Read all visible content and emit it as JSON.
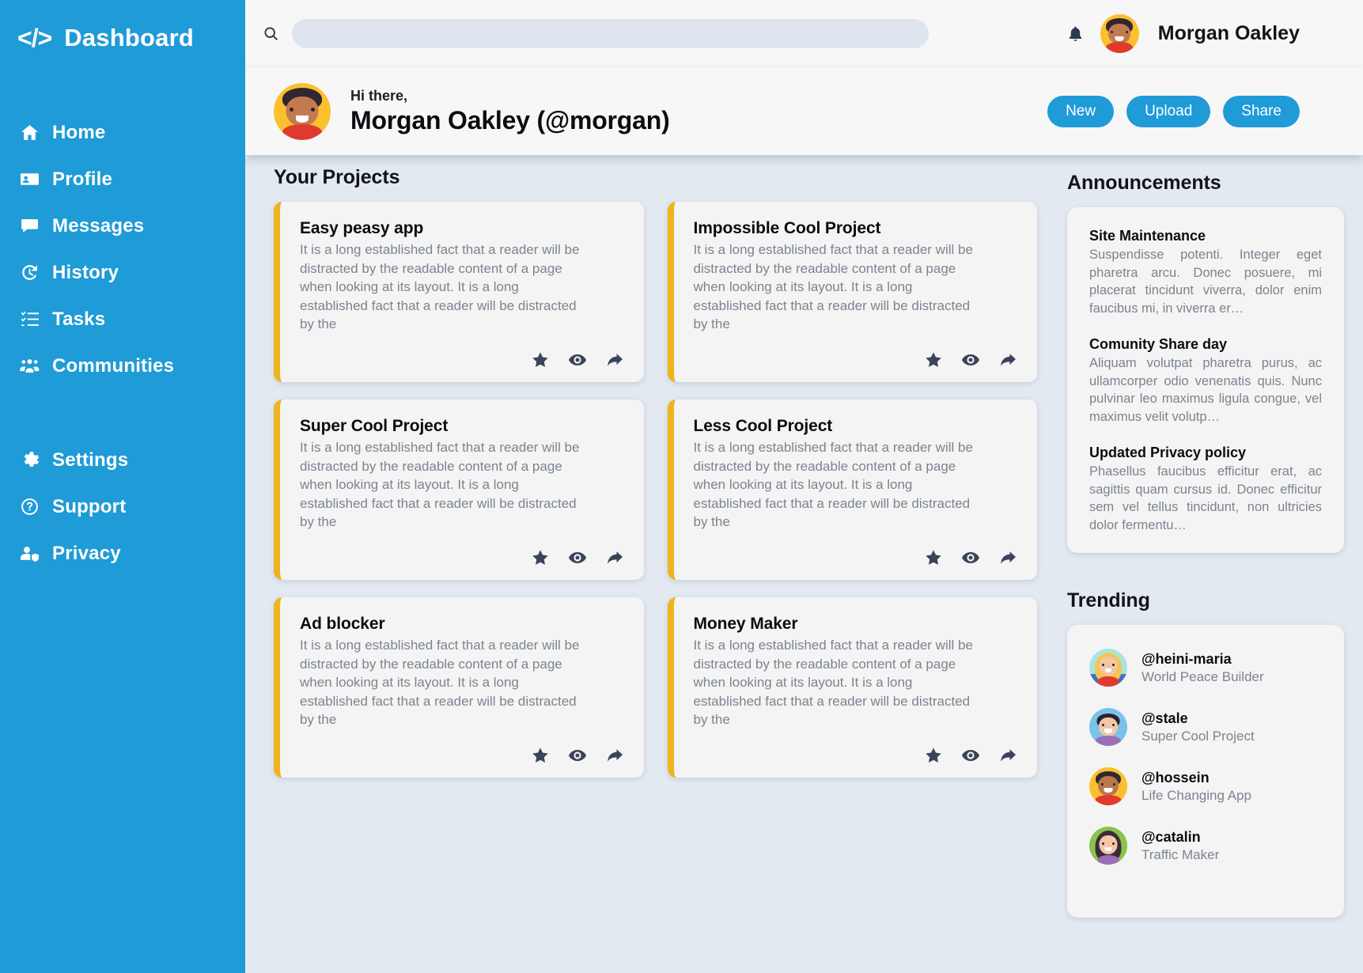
{
  "theme": {
    "sidebar_bg": "#1f9bd7",
    "accent_blue": "#1f9bd7",
    "card_accent": "#efb31e",
    "page_bg": "#e3e9f1",
    "card_bg": "#f4f4f4",
    "muted_text": "#7b8490"
  },
  "sidebar": {
    "logo_glyph": "</>",
    "logo_icon_name": "code-icon",
    "title": "Dashboard",
    "items": [
      {
        "label": "Home",
        "icon": "home-icon"
      },
      {
        "label": "Profile",
        "icon": "id-card-icon"
      },
      {
        "label": "Messages",
        "icon": "chat-bubble-icon"
      },
      {
        "label": "History",
        "icon": "history-clock-icon"
      },
      {
        "label": "Tasks",
        "icon": "checklist-icon"
      },
      {
        "label": "Communities",
        "icon": "people-group-icon"
      }
    ],
    "footer_items": [
      {
        "label": "Settings",
        "icon": "gear-icon"
      },
      {
        "label": "Support",
        "icon": "question-circle-icon"
      },
      {
        "label": "Privacy",
        "icon": "user-shield-icon"
      }
    ]
  },
  "topbar": {
    "search": {
      "value": "",
      "placeholder": "",
      "icon": "search-icon"
    },
    "bell_icon": "bell-icon",
    "avatar_icon": "user-avatar",
    "user_name": "Morgan Oakley"
  },
  "greeting": {
    "avatar_icon": "user-avatar-large",
    "hi_label": "Hi there,",
    "name": "Morgan Oakley (@morgan)",
    "actions": [
      {
        "label": "New"
      },
      {
        "label": "Upload"
      },
      {
        "label": "Share"
      }
    ]
  },
  "projects": {
    "heading": "Your Projects",
    "card_actions": [
      {
        "name": "star-icon",
        "title": "Favorite"
      },
      {
        "name": "eye-icon",
        "title": "View"
      },
      {
        "name": "share-icon",
        "title": "Share"
      }
    ],
    "items": [
      {
        "title": "Easy peasy app",
        "body": "It is a long established fact that a reader will be distracted by the readable content of a page when looking at its layout. It is a long established fact that a reader will be distracted by the"
      },
      {
        "title": "Impossible Cool Project",
        "body": "It is a long established fact that a reader will be distracted by the readable content of a page when looking at its layout. It is a long established fact that a reader will be distracted by the"
      },
      {
        "title": "Super Cool Project",
        "body": "It is a long established fact that a reader will be distracted by the readable content of a page when looking at its layout. It is a long established fact that a reader will be distracted by the"
      },
      {
        "title": "Less Cool Project",
        "body": "It is a long established fact that a reader will be distracted by the readable content of a page when looking at its layout. It is a long established fact that a reader will be distracted by the"
      },
      {
        "title": "Ad blocker",
        "body": "It is a long established fact that a reader will be distracted by the readable content of a page when looking at its layout. It is a long established fact that a reader will be distracted by the"
      },
      {
        "title": "Money Maker",
        "body": "It is a long established fact that a reader will be distracted by the readable content of a page when looking at its layout. It is a long established fact that a reader will be distracted by the"
      }
    ]
  },
  "announcements": {
    "heading": "Announcements",
    "items": [
      {
        "title": "Site Maintenance",
        "text": "Suspendisse potenti. Integer eget pharetra arcu. Donec posuere, mi placerat tincidunt viverra, dolor enim faucibus mi, in viverra er…"
      },
      {
        "title": "Comunity Share day",
        "text": "Aliquam volutpat pharetra purus, ac ullamcorper odio venenatis quis. Nunc pulvinar leo maximus ligula congue, vel maximus velit volutp…"
      },
      {
        "title": "Updated Privacy policy",
        "text": "Phasellus faucibus efficitur erat, ac sagittis quam cursus id. Donec efficitur sem vel tellus tincidunt, non ultricies dolor fermentu…"
      }
    ]
  },
  "trending": {
    "heading": "Trending",
    "items": [
      {
        "handle": "@heini-maria",
        "subtitle": "World Peace Builder",
        "avatar_icon": "avatar-heini-maria"
      },
      {
        "handle": "@stale",
        "subtitle": "Super Cool Project",
        "avatar_icon": "avatar-stale"
      },
      {
        "handle": "@hossein",
        "subtitle": "Life Changing App",
        "avatar_icon": "avatar-hossein"
      },
      {
        "handle": "@catalin",
        "subtitle": "Traffic Maker",
        "avatar_icon": "avatar-catalin"
      }
    ]
  }
}
